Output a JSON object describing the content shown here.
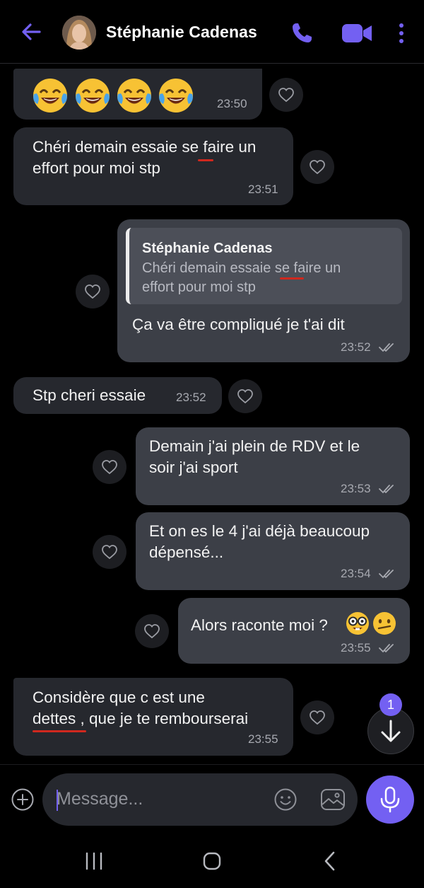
{
  "header": {
    "contact_name": "Stéphanie Cadenas",
    "back_icon": "arrow-left-icon",
    "call_icon": "phone-icon",
    "video_icon": "video-camera-icon",
    "menu_icon": "more-vertical-icon",
    "accent_color": "#7360f2"
  },
  "messages": [
    {
      "direction": "in",
      "emojis": [
        "😂",
        "😂",
        "😂",
        "😂"
      ],
      "time": "23:50"
    },
    {
      "direction": "in",
      "text": "Chéri demain essaie se faire un\neffort pour moi stp",
      "time": "23:51"
    },
    {
      "direction": "out",
      "quote_name": "Stéphanie Cadenas",
      "quote_text": "Chéri demain essaie se faire un\neffort pour moi stp",
      "text": "Ça va être compliqué je t'ai dit",
      "time": "23:52"
    },
    {
      "direction": "in",
      "text": "Stp cheri essaie",
      "time": "23:52"
    },
    {
      "direction": "out",
      "text": "Demain j'ai plein de RDV et le\nsoir j'ai sport",
      "time": "23:53"
    },
    {
      "direction": "out",
      "text": "Et on es le 4 j'ai déjà beaucoup\ndépensé...",
      "time": "23:54"
    },
    {
      "direction": "out",
      "text": "Alors raconte moi ?",
      "emojis": [
        "🤓",
        "😕"
      ],
      "time": "23:55"
    },
    {
      "direction": "in",
      "text": "Considère que c est une\ndettes , que je te rembourserai",
      "time": "23:55"
    }
  ],
  "scroll_to_bottom": {
    "badge": "1",
    "icon": "arrow-down-icon"
  },
  "composer": {
    "placeholder": "Message...",
    "plus_icon": "plus-circle-icon",
    "sticker_icon": "smiley-icon",
    "gallery_icon": "image-icon",
    "mic_icon": "microphone-icon"
  },
  "system_nav": {
    "recents_icon": "recents-icon",
    "home_icon": "home-icon",
    "back_icon": "chevron-left-icon"
  }
}
